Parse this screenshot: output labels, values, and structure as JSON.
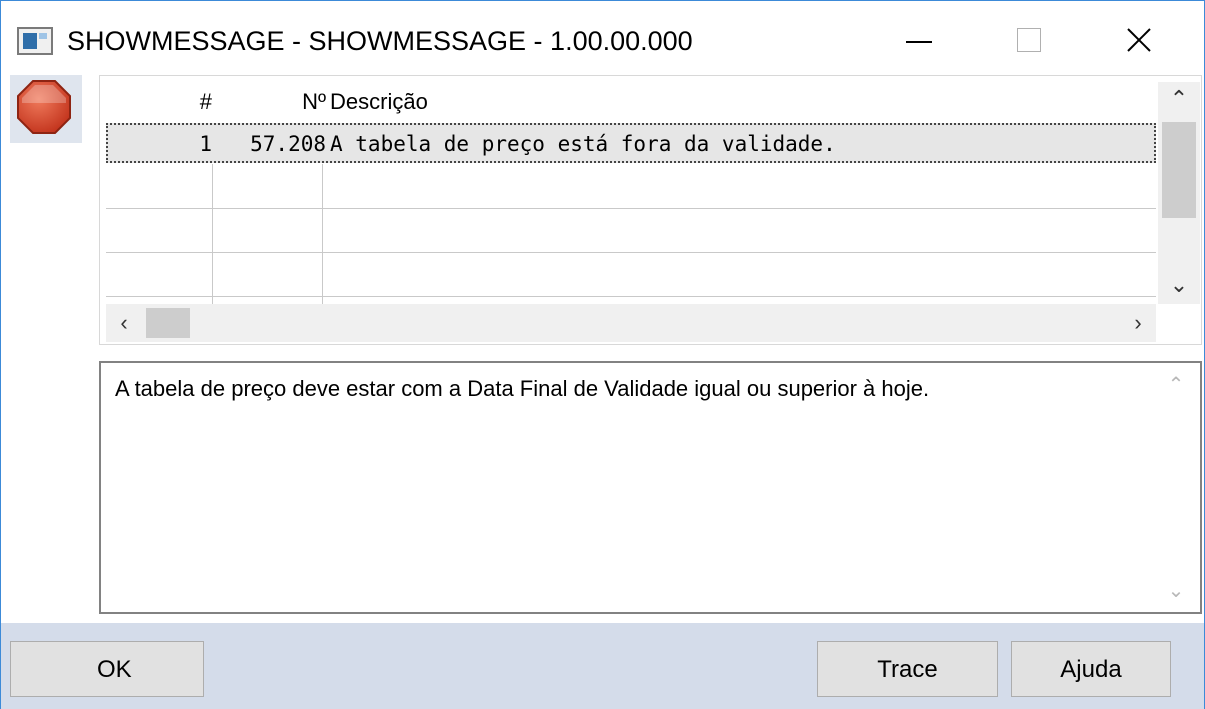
{
  "window": {
    "title": "SHOWMESSAGE - SHOWMESSAGE - 1.00.00.000"
  },
  "icons": {
    "app": "app-window-icon",
    "status": "stop-sign-icon",
    "minimize": "minimize-icon",
    "maximize": "maximize-icon",
    "close": "close-icon"
  },
  "colors": {
    "accent": "#3c8ad8",
    "stop": "#d9452b",
    "footer": "#d4dcea"
  },
  "grid": {
    "columns": [
      "#",
      "Nº",
      "Descrição"
    ],
    "rows": [
      {
        "num": "1",
        "no": "57.208",
        "desc": "A tabela de preço está fora da validade."
      }
    ]
  },
  "detail": {
    "text": "A tabela de preço deve estar com a Data Final de Validade igual ou superior à hoje."
  },
  "buttons": {
    "ok": "OK",
    "trace": "Trace",
    "help": "Ajuda"
  }
}
